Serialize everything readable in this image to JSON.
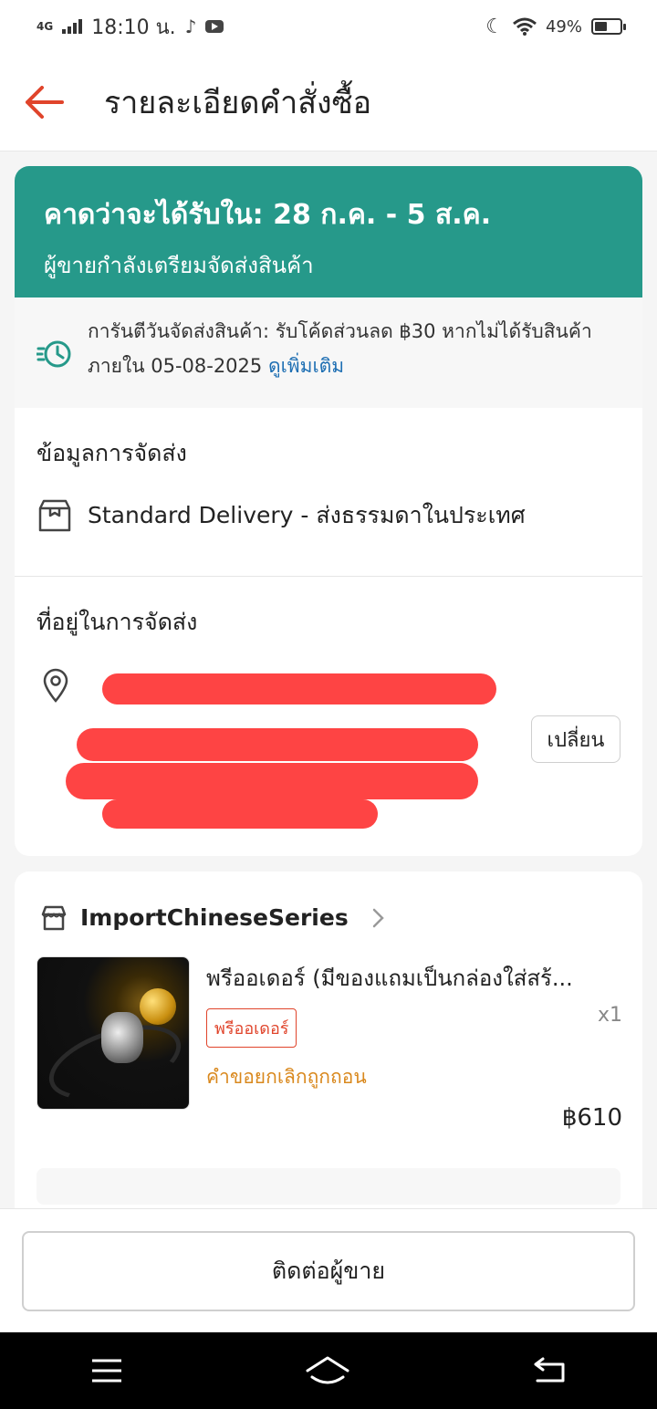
{
  "status_bar": {
    "network": "4G",
    "time": "18:10 น.",
    "battery_percent": "49%",
    "battery_level": 0.49
  },
  "header": {
    "title": "รายละเอียดคำสั่งซื้อ"
  },
  "eta": {
    "main": "คาดว่าจะได้รับใน: 28 ก.ค. - 5 ส.ค.",
    "sub": "ผู้ขายกำลังเตรียมจัดส่งสินค้า"
  },
  "guarantee": {
    "text": "การันตีวันจัดส่งสินค้า: รับโค้ดส่วนลด ฿30 หากไม่ได้รับสินค้าภายใน 05-08-2025",
    "link": "ดูเพิ่มเติม"
  },
  "shipping": {
    "title": "ข้อมูลการจัดส่ง",
    "method": "Standard Delivery - ส่งธรรมดาในประเทศ"
  },
  "address": {
    "title": "ที่อยู่ในการจัดส่ง",
    "change_label": "เปลี่ยน"
  },
  "shop": {
    "name": "ImportChineseSeries"
  },
  "product": {
    "name": "พรีออเดอร์ (มีของแถมเป็นกล่องใส่สร้...",
    "tag": "พรีออเดอร์",
    "qty": "x1",
    "status": "คำขอยกเลิกถูกถอน",
    "price": "฿610"
  },
  "footer": {
    "contact_label": "ติดต่อผู้ขาย"
  },
  "colors": {
    "accent": "#26998a",
    "back_arrow": "#e0442b",
    "redaction": "#fe4444",
    "link": "#1e6fb3",
    "cancel_status": "#d9881d"
  }
}
